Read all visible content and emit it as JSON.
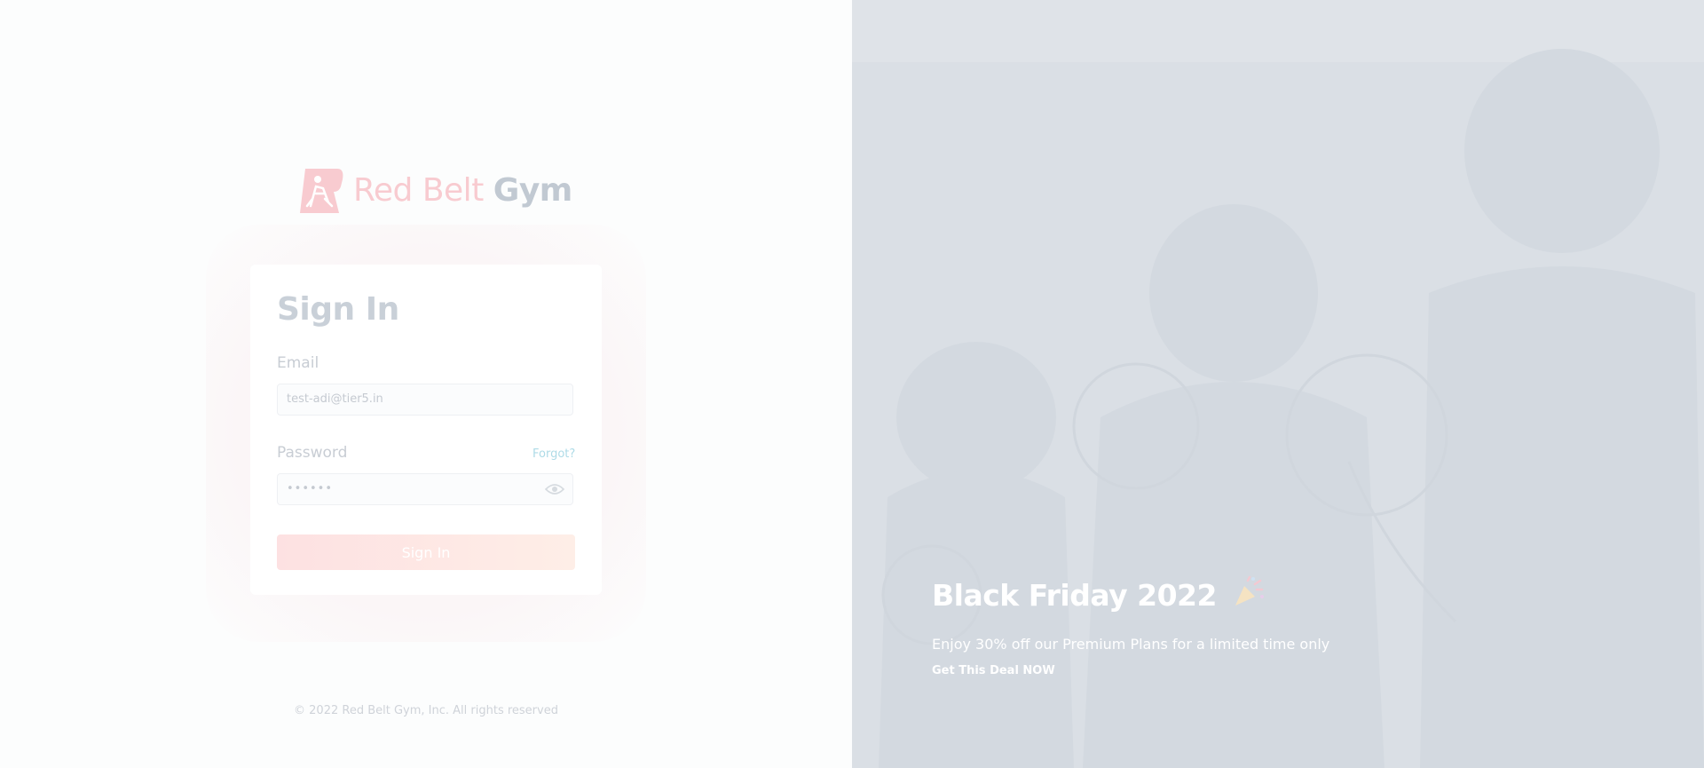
{
  "brand": {
    "name_part1": "Red Belt",
    "name_part2": "Gym",
    "logo_icon": "martial-artist-icon",
    "accent_color": "#f8cbd0"
  },
  "signin": {
    "title": "Sign In",
    "email_label": "Email",
    "email_value": "test-adi@tier5.in",
    "password_label": "Password",
    "forgot_label": "Forgot?",
    "password_value": "••••••",
    "show_password_icon": "eye-icon",
    "submit_label": "Sign In"
  },
  "footer": {
    "copyright": "© 2022 Red Belt Gym, Inc. All rights reserved"
  },
  "promo": {
    "title": "Black Friday 2022",
    "title_icon": "party-popper-icon",
    "subtitle": "Enjoy 30% off our Premium Plans for a limited time only",
    "cta_label": "Get This Deal NOW"
  }
}
